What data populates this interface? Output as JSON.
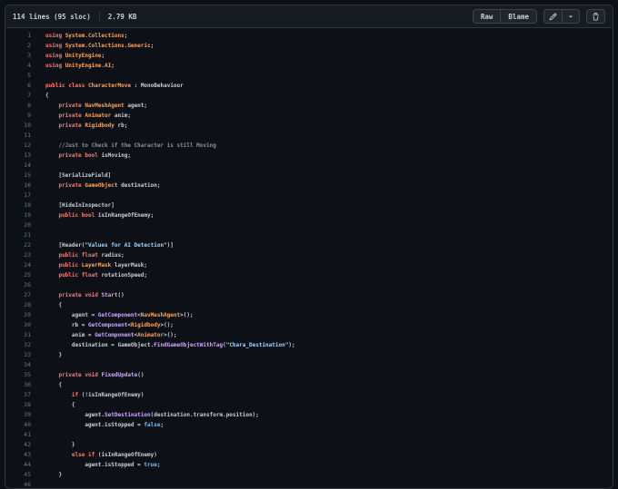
{
  "header": {
    "file_info": "114 lines (95 sloc)",
    "file_size": "2.79 KB",
    "raw_label": "Raw",
    "blame_label": "Blame",
    "icons": {
      "edit": "pencil-icon",
      "edit_dropdown": "chevron-down-icon",
      "delete": "trash-icon"
    }
  },
  "colors": {
    "page_background": "#0d1117",
    "header_background": "#161b22",
    "border": "#30363d",
    "button_background": "#21262d",
    "text": "#c9d1d9",
    "line_number": "#6e7681",
    "keyword": "#ff7b72",
    "type": "#ffa657",
    "function": "#d2a8ff",
    "string": "#a5d6ff",
    "constant": "#79c0ff",
    "comment": "#8b949e"
  },
  "code": {
    "language": "csharp",
    "lines": [
      {
        "n": 1,
        "tokens": [
          [
            "using",
            "k"
          ],
          [
            " ",
            "p"
          ],
          [
            "System.Collections",
            "t"
          ],
          [
            ";",
            "p"
          ]
        ]
      },
      {
        "n": 2,
        "tokens": [
          [
            "using",
            "k"
          ],
          [
            " ",
            "p"
          ],
          [
            "System.Collections.Generic",
            "t"
          ],
          [
            ";",
            "p"
          ]
        ]
      },
      {
        "n": 3,
        "tokens": [
          [
            "using",
            "k"
          ],
          [
            " ",
            "p"
          ],
          [
            "UnityEngine",
            "t"
          ],
          [
            ";",
            "p"
          ]
        ]
      },
      {
        "n": 4,
        "tokens": [
          [
            "using",
            "k"
          ],
          [
            " ",
            "p"
          ],
          [
            "UnityEngine.AI",
            "t"
          ],
          [
            ";",
            "p"
          ]
        ]
      },
      {
        "n": 5,
        "tokens": []
      },
      {
        "n": 6,
        "tokens": [
          [
            "public",
            "k"
          ],
          [
            " ",
            "p"
          ],
          [
            "class",
            "k"
          ],
          [
            " ",
            "p"
          ],
          [
            "CharacterMove",
            "t"
          ],
          [
            " : ",
            "p"
          ],
          [
            "MonoBehaviour",
            "p"
          ]
        ]
      },
      {
        "n": 7,
        "tokens": [
          [
            "{",
            "p"
          ]
        ]
      },
      {
        "n": 8,
        "tokens": [
          [
            "    ",
            "p"
          ],
          [
            "private",
            "k"
          ],
          [
            " ",
            "p"
          ],
          [
            "NavMeshAgent",
            "t"
          ],
          [
            " agent;",
            "p"
          ]
        ]
      },
      {
        "n": 9,
        "tokens": [
          [
            "    ",
            "p"
          ],
          [
            "private",
            "k"
          ],
          [
            " ",
            "p"
          ],
          [
            "Animator",
            "t"
          ],
          [
            " anim;",
            "p"
          ]
        ]
      },
      {
        "n": 10,
        "tokens": [
          [
            "    ",
            "p"
          ],
          [
            "private",
            "k"
          ],
          [
            " ",
            "p"
          ],
          [
            "Rigidbody",
            "t"
          ],
          [
            " rb;",
            "p"
          ]
        ]
      },
      {
        "n": 11,
        "tokens": []
      },
      {
        "n": 12,
        "tokens": [
          [
            "    ",
            "p"
          ],
          [
            "//Just to Check if the Character is still Moving",
            "c"
          ]
        ]
      },
      {
        "n": 13,
        "tokens": [
          [
            "    ",
            "p"
          ],
          [
            "private",
            "k"
          ],
          [
            " ",
            "p"
          ],
          [
            "bool",
            "k"
          ],
          [
            " isMoving;",
            "p"
          ]
        ]
      },
      {
        "n": 14,
        "tokens": []
      },
      {
        "n": 15,
        "tokens": [
          [
            "    [SerializeField]",
            "p"
          ]
        ]
      },
      {
        "n": 16,
        "tokens": [
          [
            "    ",
            "p"
          ],
          [
            "private",
            "k"
          ],
          [
            " ",
            "p"
          ],
          [
            "GameObject",
            "t"
          ],
          [
            " destination;",
            "p"
          ]
        ]
      },
      {
        "n": 17,
        "tokens": []
      },
      {
        "n": 18,
        "tokens": [
          [
            "    [HideInInspector]",
            "p"
          ]
        ]
      },
      {
        "n": 19,
        "tokens": [
          [
            "    ",
            "p"
          ],
          [
            "public",
            "k"
          ],
          [
            " ",
            "p"
          ],
          [
            "bool",
            "k"
          ],
          [
            " isInRangeOfEnemy;",
            "p"
          ]
        ]
      },
      {
        "n": 20,
        "tokens": []
      },
      {
        "n": 21,
        "tokens": []
      },
      {
        "n": 22,
        "tokens": [
          [
            "    [Header(",
            "p"
          ],
          [
            "\"Values for AI Detection\"",
            "s"
          ],
          [
            ")]",
            "p"
          ]
        ]
      },
      {
        "n": 23,
        "tokens": [
          [
            "    ",
            "p"
          ],
          [
            "public",
            "k"
          ],
          [
            " ",
            "p"
          ],
          [
            "float",
            "k"
          ],
          [
            " radius;",
            "p"
          ]
        ]
      },
      {
        "n": 24,
        "tokens": [
          [
            "    ",
            "p"
          ],
          [
            "public",
            "k"
          ],
          [
            " ",
            "p"
          ],
          [
            "LayerMask",
            "t"
          ],
          [
            " layerMask;",
            "p"
          ]
        ]
      },
      {
        "n": 25,
        "tokens": [
          [
            "    ",
            "p"
          ],
          [
            "public",
            "k"
          ],
          [
            " ",
            "p"
          ],
          [
            "float",
            "k"
          ],
          [
            " rotationSpeed;",
            "p"
          ]
        ]
      },
      {
        "n": 26,
        "tokens": []
      },
      {
        "n": 27,
        "tokens": [
          [
            "    ",
            "p"
          ],
          [
            "private",
            "k"
          ],
          [
            " ",
            "p"
          ],
          [
            "void",
            "k"
          ],
          [
            " ",
            "p"
          ],
          [
            "Start",
            "f"
          ],
          [
            "()",
            "p"
          ]
        ]
      },
      {
        "n": 28,
        "tokens": [
          [
            "    {",
            "p"
          ]
        ]
      },
      {
        "n": 29,
        "tokens": [
          [
            "        agent = ",
            "p"
          ],
          [
            "GetComponent",
            "f"
          ],
          [
            "<",
            "p"
          ],
          [
            "NavMeshAgent",
            "t"
          ],
          [
            ">();",
            "p"
          ]
        ]
      },
      {
        "n": 30,
        "tokens": [
          [
            "        rb = ",
            "p"
          ],
          [
            "GetComponent",
            "f"
          ],
          [
            "<",
            "p"
          ],
          [
            "Rigidbody",
            "t"
          ],
          [
            ">();",
            "p"
          ]
        ]
      },
      {
        "n": 31,
        "tokens": [
          [
            "        anim = ",
            "p"
          ],
          [
            "GetComponent",
            "f"
          ],
          [
            "<",
            "p"
          ],
          [
            "Animator",
            "t"
          ],
          [
            ">();",
            "p"
          ]
        ]
      },
      {
        "n": 32,
        "tokens": [
          [
            "        destination = GameObject.",
            "p"
          ],
          [
            "FindGameObjectWithTag",
            "f"
          ],
          [
            "(",
            "p"
          ],
          [
            "\"Chara_Destination\"",
            "s"
          ],
          [
            ");",
            "p"
          ]
        ]
      },
      {
        "n": 33,
        "tokens": [
          [
            "    }",
            "p"
          ]
        ]
      },
      {
        "n": 34,
        "tokens": []
      },
      {
        "n": 35,
        "tokens": [
          [
            "    ",
            "p"
          ],
          [
            "private",
            "k"
          ],
          [
            " ",
            "p"
          ],
          [
            "void",
            "k"
          ],
          [
            " ",
            "p"
          ],
          [
            "FixedUpdate",
            "f"
          ],
          [
            "()",
            "p"
          ]
        ]
      },
      {
        "n": 36,
        "tokens": [
          [
            "    {",
            "p"
          ]
        ]
      },
      {
        "n": 37,
        "tokens": [
          [
            "        ",
            "p"
          ],
          [
            "if",
            "k"
          ],
          [
            " (!isInRangeOfEnemy)",
            "p"
          ]
        ]
      },
      {
        "n": 38,
        "tokens": [
          [
            "        {",
            "p"
          ]
        ]
      },
      {
        "n": 39,
        "tokens": [
          [
            "            agent.",
            "p"
          ],
          [
            "SetDestination",
            "f"
          ],
          [
            "(destination.transform.position);",
            "p"
          ]
        ]
      },
      {
        "n": 40,
        "tokens": [
          [
            "            agent.isStopped = ",
            "p"
          ],
          [
            "false",
            "b"
          ],
          [
            ";",
            "p"
          ]
        ]
      },
      {
        "n": 41,
        "tokens": []
      },
      {
        "n": 42,
        "tokens": [
          [
            "        }",
            "p"
          ]
        ]
      },
      {
        "n": 43,
        "tokens": [
          [
            "        ",
            "p"
          ],
          [
            "else",
            "k"
          ],
          [
            " ",
            "p"
          ],
          [
            "if",
            "k"
          ],
          [
            " (isInRangeOfEnemy)",
            "p"
          ]
        ]
      },
      {
        "n": 44,
        "tokens": [
          [
            "            agent.isStopped = ",
            "p"
          ],
          [
            "true",
            "b"
          ],
          [
            ";",
            "p"
          ]
        ]
      },
      {
        "n": 45,
        "tokens": [
          [
            "    }",
            "p"
          ]
        ]
      },
      {
        "n": 46,
        "tokens": []
      }
    ]
  }
}
